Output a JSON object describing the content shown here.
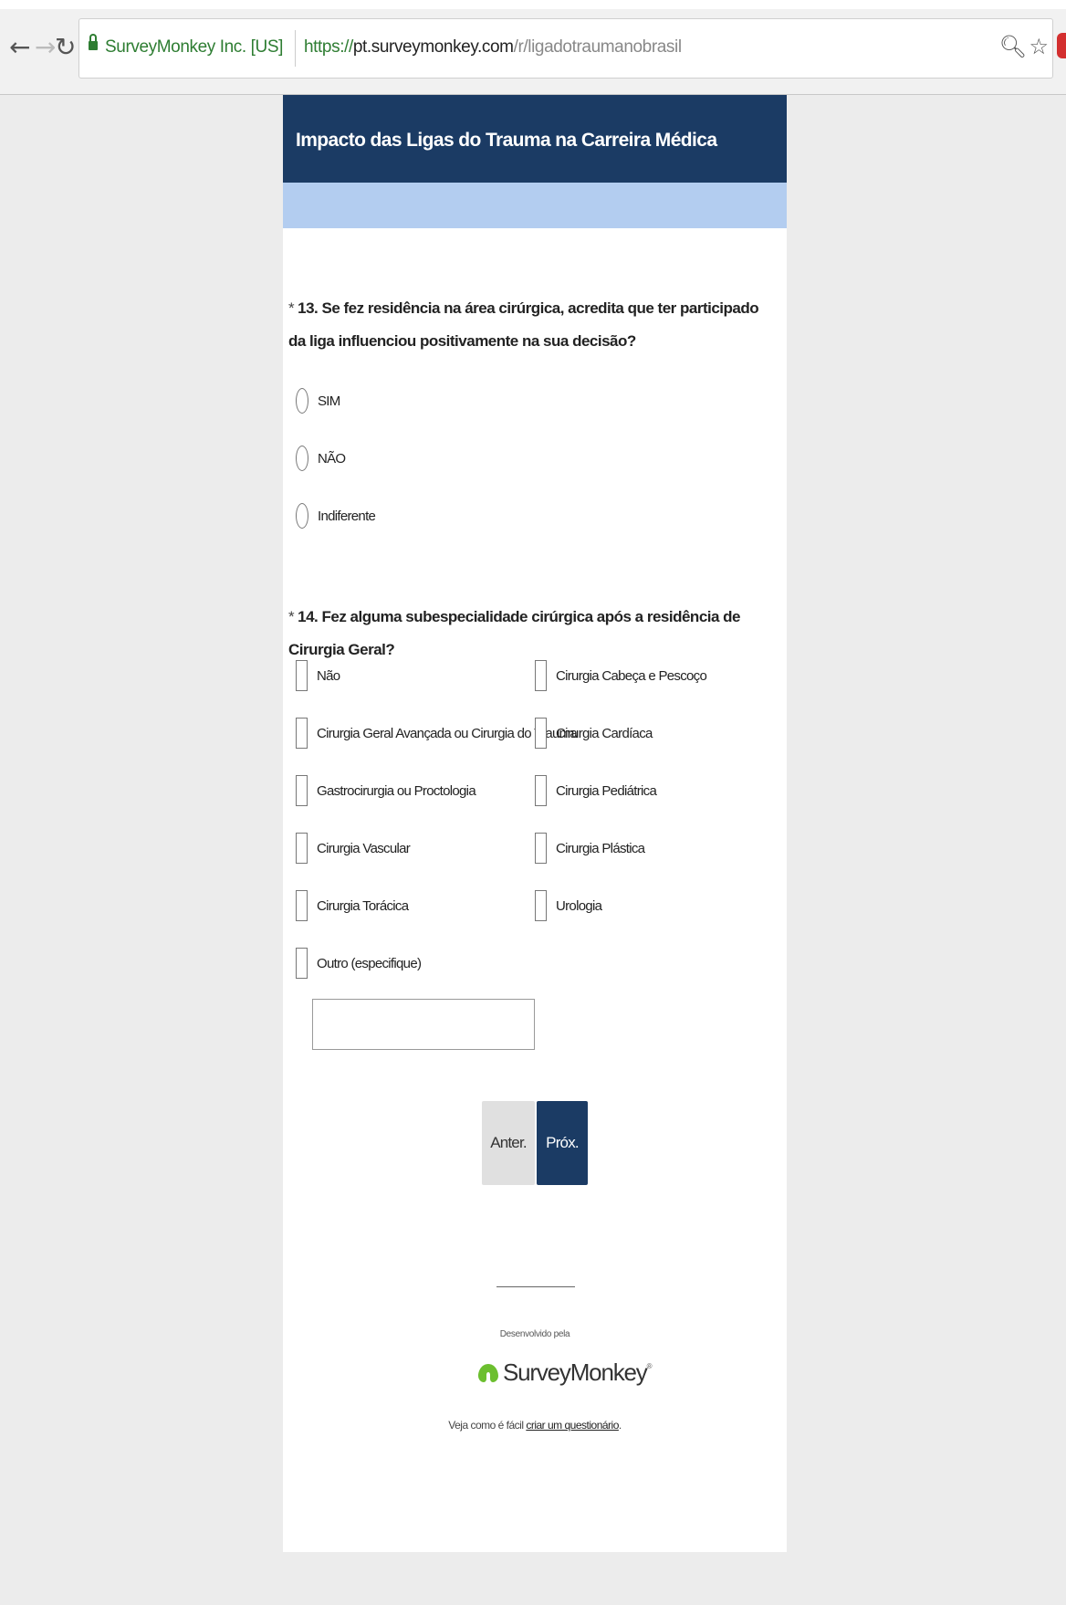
{
  "browser": {
    "site_name": "SurveyMonkey Inc. [US]",
    "url_scheme": "https://",
    "url_host": "pt.surveymonkey.com",
    "url_path": "/r/ligadotraumanobrasil"
  },
  "survey": {
    "title": "Impacto das Ligas do Trauma na Carreira Médica",
    "q13": {
      "required_mark": "*",
      "title": "13. Se fez residência na área cirúrgica, acredita que ter participado da liga influenciou positivamente na sua decisão?",
      "options": [
        "SIM",
        "NÃO",
        "Indiferente"
      ]
    },
    "q14": {
      "required_mark": "*",
      "title": "14. Fez alguma subespecialidade cirúrgica após a residência de Cirurgia Geral?",
      "options_left": [
        "Não",
        "Cirurgia Geral Avançada ou Cirurgia do Trauma",
        "Gastrocirurgia ou Proctologia",
        "Cirurgia Vascular",
        "Cirurgia Torácica",
        "Outro (especifique)"
      ],
      "options_right": [
        "Cirurgia Cabeça e Pescoço",
        "Cirurgia Cardíaca",
        "Cirurgia Pediátrica",
        "Cirurgia Plástica",
        "Urologia"
      ],
      "other_value": ""
    },
    "buttons": {
      "prev": "Anter.",
      "next": "Próx."
    }
  },
  "footer": {
    "powered_by": "Desenvolvido pela",
    "brand": "SurveyMonkey",
    "reg_mark": "®",
    "tagline_prefix": "Veja como é fácil",
    "tagline_link": "criar um questionário",
    "tagline_suffix": "."
  },
  "colors": {
    "header_bg": "#1b3b64",
    "progress_bg": "#b3cdf0",
    "page_bg": "#ececec",
    "secure_green": "#2e7d32",
    "logo_green": "#6cbf2f"
  },
  "icons": [
    "back-arrow-icon",
    "forward-arrow-icon",
    "reload-icon",
    "lock-icon",
    "zoom-icon",
    "star-icon",
    "surveymonkey-logo-icon"
  ]
}
